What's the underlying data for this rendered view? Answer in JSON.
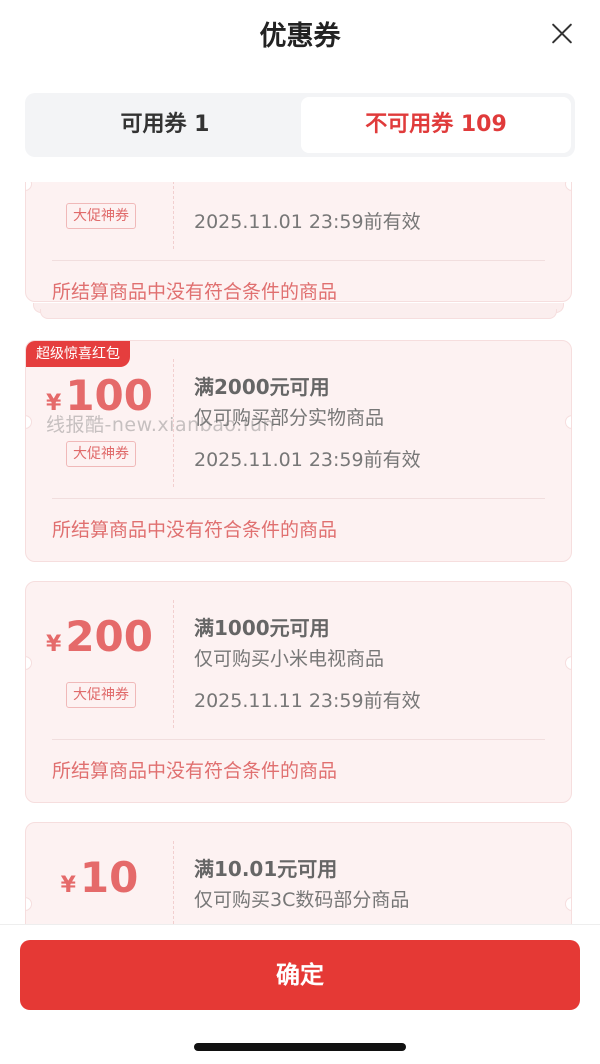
{
  "header": {
    "title": "优惠券"
  },
  "tabs": [
    {
      "label": "可用券 1",
      "active": false
    },
    {
      "label": "不可用券 109",
      "active": true
    }
  ],
  "coupons": [
    {
      "currency": "",
      "amount": "",
      "tag": "大促神券",
      "condition": "",
      "scope": "",
      "expire": "2025.11.01 23:59前有效",
      "reason": "所结算商品中没有符合条件的商品"
    },
    {
      "badge": "超级惊喜红包",
      "currency": "¥",
      "amount": "100",
      "tag": "大促神券",
      "condition": "满2000元可用",
      "scope": "仅可购买部分实物商品",
      "expire": "2025.11.01 23:59前有效",
      "reason": "所结算商品中没有符合条件的商品"
    },
    {
      "currency": "¥",
      "amount": "200",
      "tag": "大促神券",
      "condition": "满1000元可用",
      "scope": "仅可购买小米电视商品",
      "expire": "2025.11.11 23:59前有效",
      "reason": "所结算商品中没有符合条件的商品"
    },
    {
      "currency": "¥",
      "amount": "10",
      "condition": "满10.01元可用",
      "scope": "仅可购买3C数码部分商品"
    }
  ],
  "watermark": "线报酷-new.xianbao.fun",
  "footer": {
    "confirm_label": "确定"
  },
  "colors": {
    "accent": "#e53935",
    "card_bg": "#fdf2f2",
    "amount": "#e56a6a"
  }
}
